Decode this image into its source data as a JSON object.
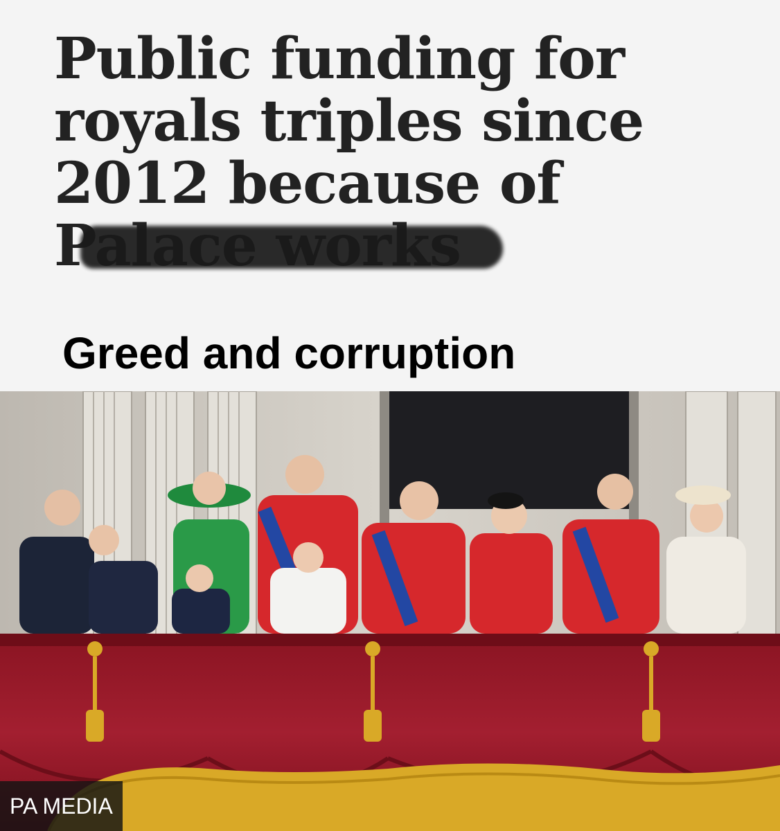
{
  "headline": {
    "line1": "Public funding for",
    "line2": "royals triples since",
    "line3": "2012 because of",
    "line4": "Palace works"
  },
  "overlay_caption": "Greed and corruption",
  "photo": {
    "credit": "PA MEDIA",
    "colors": {
      "drape": "#9c1b2a",
      "fringe": "#d9a927",
      "uniform_red": "#d6282c",
      "dress_green": "#2a9a48"
    }
  }
}
